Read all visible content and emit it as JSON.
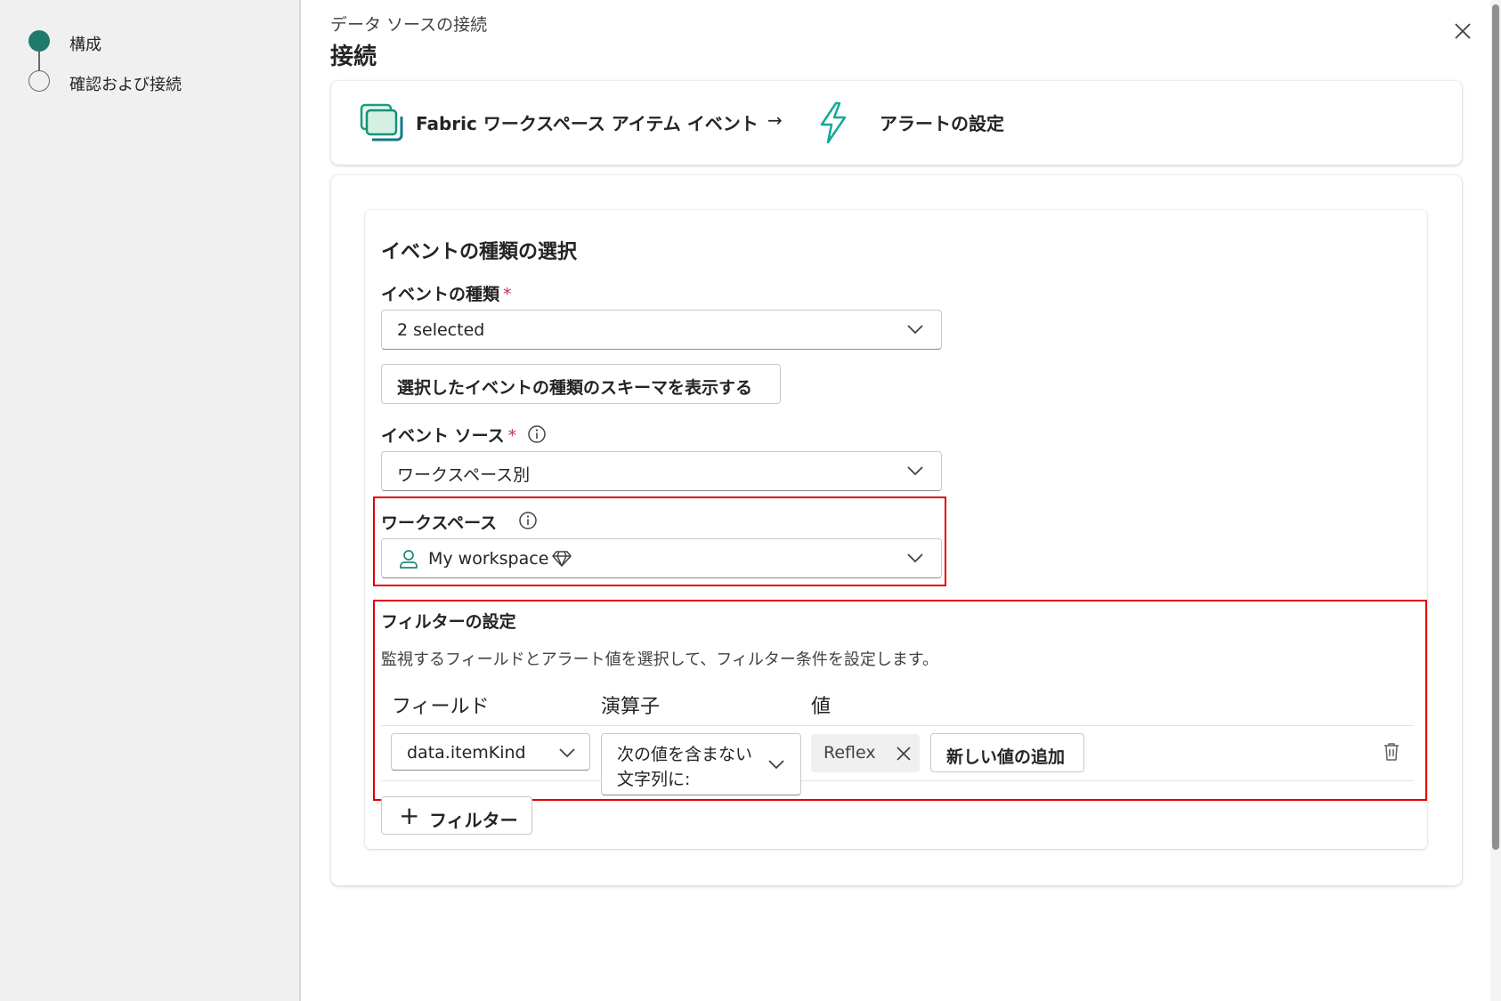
{
  "steps": [
    {
      "label": "構成",
      "state": "active"
    },
    {
      "label": "確認および接続",
      "state": "pending"
    }
  ],
  "header": {
    "subtitle": "データ ソースの接続",
    "title": "接続"
  },
  "flow": {
    "source_label": "Fabric ワークスペース アイテム イベント",
    "arrow": "→",
    "target_label": "アラートの設定",
    "source_icon": "stacked-layers-icon",
    "target_icon": "lightning-bolt-icon"
  },
  "event_section": {
    "title": "イベントの種類の選択",
    "event_type": {
      "label": "イベントの種類",
      "required_mark": "*",
      "value": "2 selected"
    },
    "schema_button": "選択したイベントの種類のスキーマを表示する",
    "event_source": {
      "label": "イベント ソース",
      "required_mark": "*",
      "value": "ワークスペース別"
    },
    "workspace": {
      "label": "ワークスペース",
      "value": "My workspace"
    }
  },
  "filter": {
    "title": "フィルターの設定",
    "description": "監視するフィールドとアラート値を選択して、フィルター条件を設定します。",
    "columns": [
      "フィールド",
      "演算子",
      "値"
    ],
    "row": {
      "field": "data.itemKind",
      "operator_line1": "次の値を含まない",
      "operator_line2": "文字列に:",
      "value_chip": "Reflex",
      "add_value_button": "新しい値の追加"
    },
    "add_filter_button": "フィルター",
    "add_filter_plus": "+"
  },
  "colors": {
    "accent_teal": "#1f7a6b",
    "highlight_red": "#e00000",
    "required_red": "#c4314b"
  }
}
